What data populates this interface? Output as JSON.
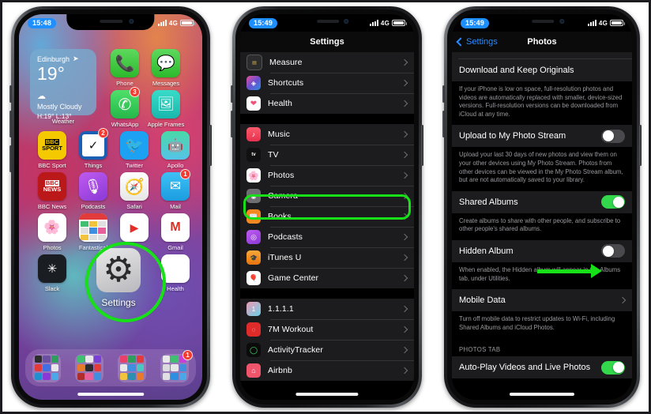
{
  "phones": [
    {
      "id": "home-screen",
      "status": {
        "time": "15:48",
        "network": "4G",
        "signal_bars": 4,
        "battery_full": true
      },
      "widget": {
        "location": "Edinburgh",
        "temperature": "19°",
        "condition": "Mostly Cloudy",
        "high_low": "H:19° L:13°",
        "label": "Weather"
      },
      "apps": [
        {
          "name": "Phone",
          "badge": null
        },
        {
          "name": "Messages",
          "badge": null
        },
        {
          "name": "WhatsApp",
          "badge": "3"
        },
        {
          "name": "Apple Frames",
          "badge": null
        },
        {
          "name": "BBC Sport",
          "badge": null
        },
        {
          "name": "Things",
          "badge": "2"
        },
        {
          "name": "Twitter",
          "badge": null
        },
        {
          "name": "Apollo",
          "badge": null
        },
        {
          "name": "BBC News",
          "badge": null
        },
        {
          "name": "Podcasts",
          "badge": null
        },
        {
          "name": "Safari",
          "badge": null
        },
        {
          "name": "Mail",
          "badge": "1"
        },
        {
          "name": "Photos",
          "badge": null
        },
        {
          "name": "Fantastical",
          "badge": null
        },
        {
          "name": "YouTube",
          "badge": null
        },
        {
          "name": "Gmail",
          "badge": null
        },
        {
          "name": "Slack",
          "badge": null
        },
        {
          "name": "Settings",
          "badge": null
        },
        {
          "name": "Health",
          "badge": null
        }
      ],
      "dock_badge": "1",
      "highlight_label": "Settings"
    },
    {
      "id": "settings-list",
      "status": {
        "time": "15:49",
        "network": "4G",
        "signal_bars": 4,
        "battery_full": true
      },
      "title": "Settings",
      "groups": [
        {
          "items": [
            {
              "label": "Measure",
              "icon": "measure-icon",
              "highlighted": false
            },
            {
              "label": "Shortcuts",
              "icon": "shortcuts-icon",
              "highlighted": false
            },
            {
              "label": "Health",
              "icon": "health-icon",
              "highlighted": false
            }
          ]
        },
        {
          "items": [
            {
              "label": "Music",
              "icon": "music-icon",
              "highlighted": false
            },
            {
              "label": "TV",
              "icon": "tv-icon",
              "highlighted": false
            },
            {
              "label": "Photos",
              "icon": "photos-icon",
              "highlighted": true
            },
            {
              "label": "Camera",
              "icon": "camera-icon",
              "highlighted": false
            },
            {
              "label": "Books",
              "icon": "books-icon",
              "highlighted": false
            },
            {
              "label": "Podcasts",
              "icon": "podcasts-icon",
              "highlighted": false
            },
            {
              "label": "iTunes U",
              "icon": "itunes-u-icon",
              "highlighted": false
            },
            {
              "label": "Game Center",
              "icon": "game-center-icon",
              "highlighted": false
            }
          ]
        },
        {
          "items": [
            {
              "label": "1.1.1.1",
              "icon": "one-one-one-one-icon",
              "highlighted": false
            },
            {
              "label": "7M Workout",
              "icon": "seven-m-workout-icon",
              "highlighted": false
            },
            {
              "label": "ActivityTracker",
              "icon": "activity-tracker-icon",
              "highlighted": false
            },
            {
              "label": "Airbnb",
              "icon": "airbnb-icon",
              "highlighted": false
            }
          ]
        }
      ]
    },
    {
      "id": "photos-settings",
      "status": {
        "time": "15:49",
        "network": "4G",
        "signal_bars": 4,
        "battery_full": true
      },
      "back_label": "Settings",
      "title": "Photos",
      "rows": [
        {
          "type": "plain",
          "label": "Download and Keep Originals",
          "footer": "If your iPhone is low on space, full-resolution photos and videos are automatically replaced with smaller, device-sized versions. Full-resolution versions can be downloaded from iCloud at any time."
        },
        {
          "type": "switch",
          "label": "Upload to My Photo Stream",
          "value": "off",
          "footer": "Upload your last 30 days of new photos and view them on your other devices using My Photo Stream. Photos from other devices can be viewed in the My Photo Stream album, but are not automatically saved to your library."
        },
        {
          "type": "switch",
          "label": "Shared Albums",
          "value": "on",
          "footer": "Create albums to share with other people, and subscribe to other people's shared albums."
        },
        {
          "type": "switch",
          "label": "Hidden Album",
          "value": "off",
          "highlighted": true,
          "footer": "When enabled, the Hidden album will appear in the Albums tab, under Utilities."
        },
        {
          "type": "disclosure",
          "label": "Mobile Data",
          "footer": "Turn off mobile data to restrict updates to Wi-Fi, including Shared Albums and iCloud Photos."
        }
      ],
      "section_header": "PHOTOS TAB",
      "last_row": {
        "type": "switch",
        "label": "Auto-Play Videos and Live Photos",
        "value": "on"
      }
    }
  ],
  "colors": {
    "highlight_green": "#18e018",
    "ios_blue": "#2b8aff",
    "toggle_on": "#32d74b",
    "toggle_off": "#4a4a4e",
    "list_bg": "#1c1c1e"
  }
}
